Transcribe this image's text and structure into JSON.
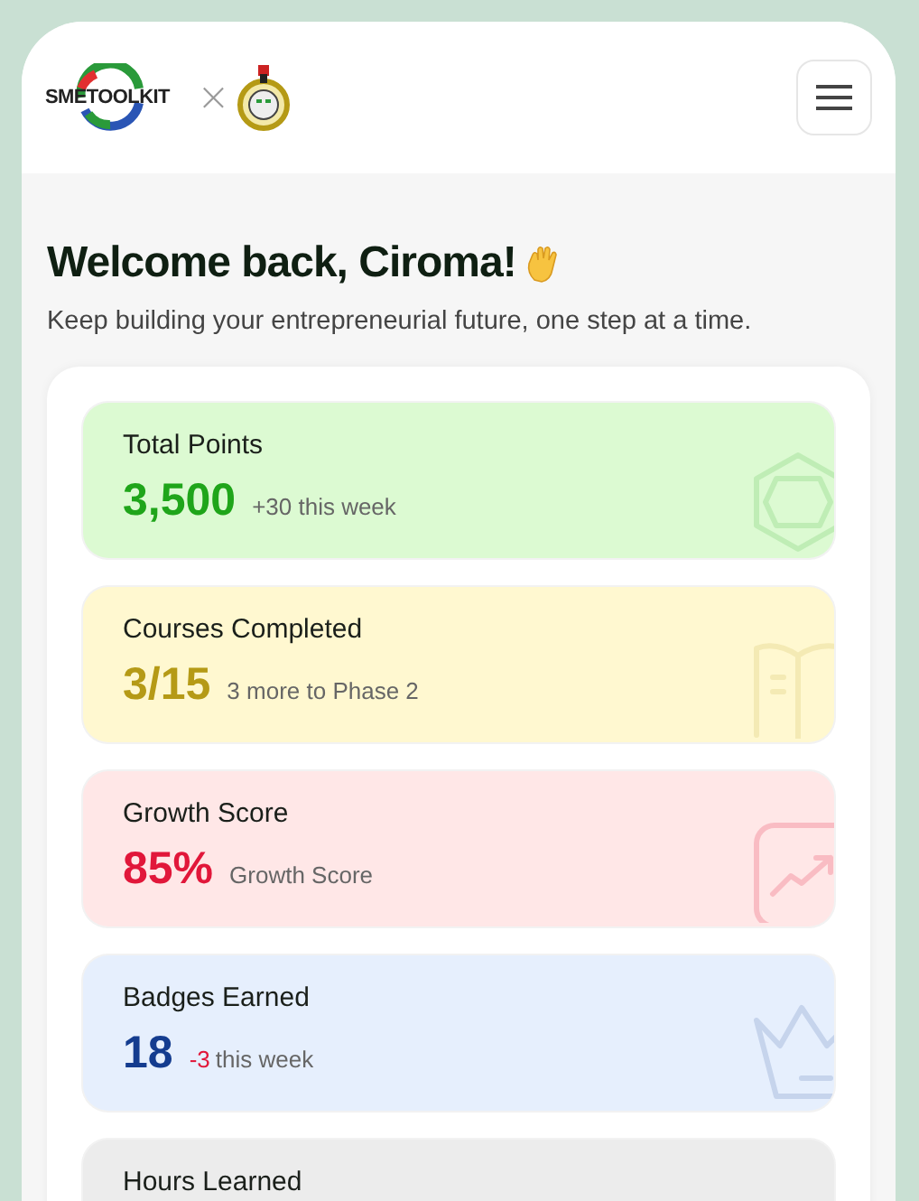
{
  "header": {
    "brand": "SMETOOLKIT",
    "separator": "×"
  },
  "welcome": {
    "title": "Welcome back, Ciroma!",
    "subtitle": "Keep building your entrepreneurial future, one step at a time."
  },
  "stats": [
    {
      "kind": "gem",
      "label": "Total Points",
      "value": "3,500",
      "note": "+30 this week",
      "color": "#1fa51a"
    },
    {
      "kind": "book",
      "label": "Courses Completed",
      "value": "3/15",
      "note": "3 more to Phase 2",
      "color": "#b59a16"
    },
    {
      "kind": "chart",
      "label": "Growth Score",
      "value": "85%",
      "note": "Growth Score",
      "color": "#e1173a"
    },
    {
      "kind": "crown",
      "label": "Badges Earned",
      "value": "18",
      "delta": "-3",
      "note": "this week",
      "color": "#143c8f"
    },
    {
      "kind": "clock",
      "label": "Hours Learned"
    }
  ]
}
